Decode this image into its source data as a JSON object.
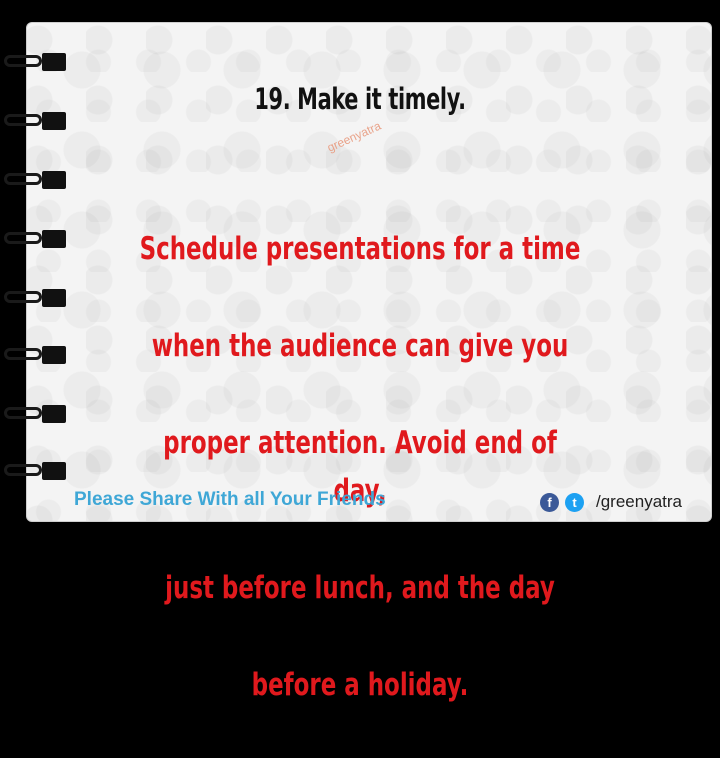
{
  "slide": {
    "title": "19. Make it timely.",
    "watermark": "greenyatra",
    "body_lines": [
      "Schedule presentations for a time",
      "when the audience can give  you",
      "proper attention.  Avoid  end of day,",
      "just before lunch, and the day",
      "before a holiday."
    ]
  },
  "footer": {
    "share_text": "Please Share With all Your Friends",
    "facebook_glyph": "f",
    "twitter_glyph": "t",
    "handle": "/greenyatra"
  },
  "colors": {
    "background": "#000000",
    "card": "#f4f4f4",
    "title": "#111111",
    "body": "#e0191d",
    "share": "#3fa7d6",
    "facebook": "#3b5998",
    "twitter": "#1da1f2"
  },
  "icons": [
    "binder-ring",
    "facebook-icon",
    "twitter-icon"
  ]
}
